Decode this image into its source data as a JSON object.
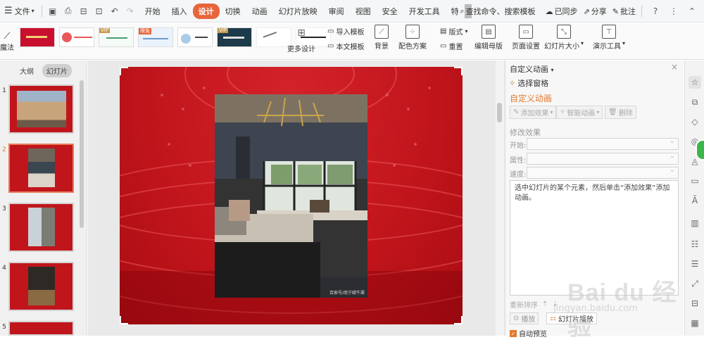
{
  "menubar": {
    "file_label": "文件",
    "tabs": [
      "开始",
      "插入",
      "设计",
      "切换",
      "动画",
      "幻灯片放映",
      "审阅",
      "视图",
      "安全",
      "开发工具",
      "特"
    ],
    "active_tab": "设计",
    "search_label": "查找命令、搜索模板",
    "sync_label": "已同步",
    "share_label": "分享",
    "comment_label": "批注"
  },
  "toolbar": {
    "magic_label": "魔法",
    "badge_vip": "VIP",
    "badge_free": "限免",
    "more_design": "更多设计",
    "import_template": "导入模板",
    "text_template": "本文模板",
    "background": "背景",
    "color_scheme": "配色方案",
    "format": "版式",
    "reset": "重置",
    "edit_master": "编辑母版",
    "page_setup": "页面设置",
    "slide_size": "幻灯片大小",
    "presentation_tools": "演示工具"
  },
  "sidebar": {
    "tab_outline": "大纲",
    "tab_slides": "幻灯片",
    "slides": [
      "1",
      "2",
      "3",
      "4",
      "5"
    ],
    "selected": "2"
  },
  "slide": {
    "photo_caption": "百家号/南宁碳牛渠"
  },
  "panel": {
    "title": "自定义动画",
    "selection_pane": "选择窗格",
    "heading": "自定义动画",
    "add_effect": "添加效果",
    "smart_animation": "智能动画",
    "delete": "删除",
    "modify_effect": "修改效果",
    "start_label": "开始:",
    "property_label": "属性:",
    "speed_label": "速度:",
    "hint": "选中幻灯片的某个元素，然后单击“添加效果”添加动画。",
    "reorder": "重新排序",
    "play": "播放",
    "slideshow": "幻灯片播放",
    "autopreview": "自动预览"
  },
  "watermark": {
    "brand": "Bai du 经验",
    "url": "jingyan.baidu.com"
  },
  "colors": {
    "accent": "#e8653c",
    "slide_red": "#c0141b",
    "panel_heading": "#e07a30"
  }
}
